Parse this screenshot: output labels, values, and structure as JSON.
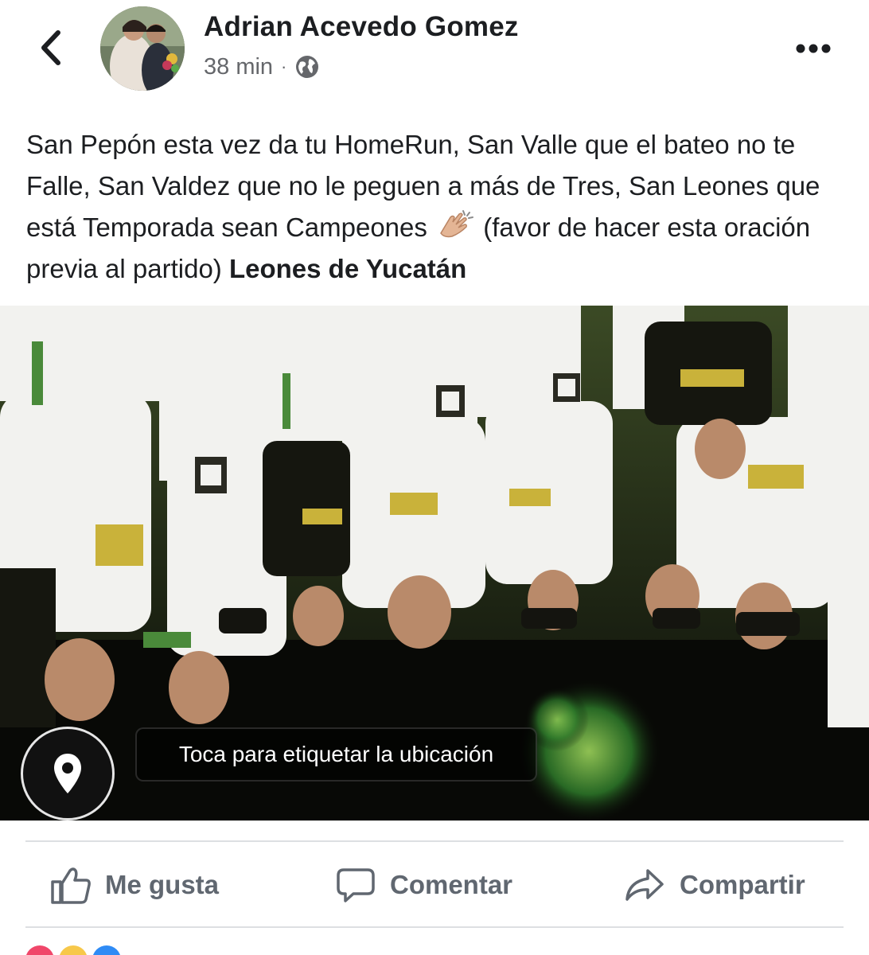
{
  "post": {
    "author": "Adrian Acevedo Gomez",
    "time": "38 min",
    "separator": "·",
    "privacy_icon": "globe-icon",
    "text_main": "San Pepón esta vez da tu HomeRun, San Valle que el bateo no te Falle, San Valdez que no le peguen a más de Tres, San Leones que está Temporada sean Campeones ",
    "text_emoji": "clapping-hands-emoji",
    "text_after": " (favor de hacer esta oración previa al partido) ",
    "mention": "Leones de Yucatán"
  },
  "photo": {
    "location_prompt": "Toca para etiquetar la ubicación",
    "location_icon": "map-pin-icon"
  },
  "actions": {
    "like_label": "Me gusta",
    "comment_label": "Comentar",
    "share_label": "Compartir"
  },
  "colors": {
    "text": "#1c1e21",
    "muted": "#65676b",
    "action": "#606770",
    "divider": "#dddfe2",
    "team_accent": "#c9b23a"
  }
}
